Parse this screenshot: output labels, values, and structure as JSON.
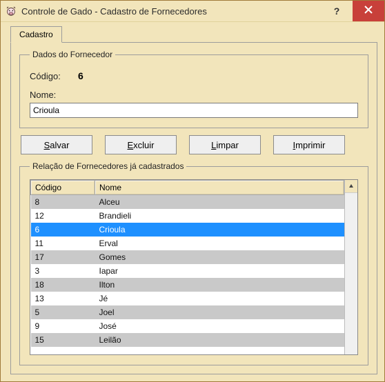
{
  "window": {
    "title": "Controle de Gado - Cadastro de Fornecedores"
  },
  "tabs": {
    "cadastro": "Cadastro"
  },
  "fornecedor": {
    "legend": "Dados do Fornecedor",
    "codigo_label": "Código:",
    "codigo_value": "6",
    "nome_label": "Nome:",
    "nome_value": "Crioula"
  },
  "buttons": {
    "salvar": "Salvar",
    "salvar_u": "S",
    "salvar_rest": "alvar",
    "excluir": "Excluir",
    "excluir_u": "E",
    "excluir_rest": "xcluir",
    "limpar": "Limpar",
    "limpar_u": "L",
    "limpar_rest": "impar",
    "imprimir": "Imprimir",
    "imprimir_u": "I",
    "imprimir_rest": "mprimir"
  },
  "lista": {
    "legend": "Relação de Fornecedores já cadastrados",
    "col_codigo": "Código",
    "col_nome": "Nome",
    "rows": [
      {
        "codigo": "8",
        "nome": "Alceu"
      },
      {
        "codigo": "12",
        "nome": "Brandieli"
      },
      {
        "codigo": "6",
        "nome": "Crioula"
      },
      {
        "codigo": "11",
        "nome": "Erval"
      },
      {
        "codigo": "17",
        "nome": "Gomes"
      },
      {
        "codigo": "3",
        "nome": "Iapar"
      },
      {
        "codigo": "18",
        "nome": "Ilton"
      },
      {
        "codigo": "13",
        "nome": "Jé"
      },
      {
        "codigo": "5",
        "nome": "Joel"
      },
      {
        "codigo": "9",
        "nome": "José"
      },
      {
        "codigo": "15",
        "nome": "Leilão"
      }
    ],
    "selected_codigo": "6",
    "stripe_start": "dark"
  }
}
